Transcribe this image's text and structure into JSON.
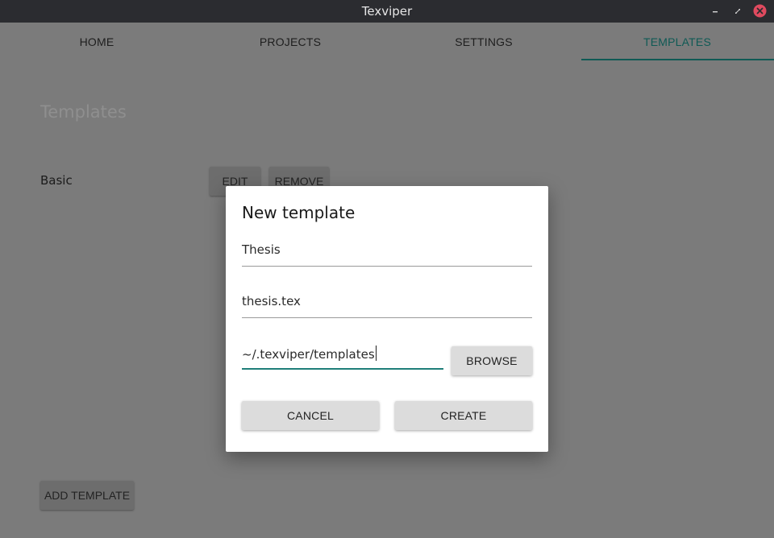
{
  "window": {
    "title": "Texviper"
  },
  "tabs": [
    {
      "label": "HOME",
      "active": false
    },
    {
      "label": "PROJECTS",
      "active": false
    },
    {
      "label": "SETTINGS",
      "active": false
    },
    {
      "label": "TEMPLATES",
      "active": true
    }
  ],
  "page": {
    "title": "Templates",
    "templates": [
      {
        "name": "Basic",
        "edit_label": "EDIT",
        "remove_label": "REMOVE"
      }
    ],
    "add_label": "ADD TEMPLATE"
  },
  "dialog": {
    "title": "New template",
    "name_value": "Thesis",
    "filename_value": "thesis.tex",
    "path_value": "~/.texviper/templates",
    "browse_label": "BROWSE",
    "cancel_label": "CANCEL",
    "create_label": "CREATE"
  },
  "colors": {
    "accent": "#0f5a55",
    "titlebar": "#2b2c30",
    "close": "#e04a5f"
  },
  "icons": [
    "minimize-icon",
    "restore-icon",
    "close-icon"
  ]
}
